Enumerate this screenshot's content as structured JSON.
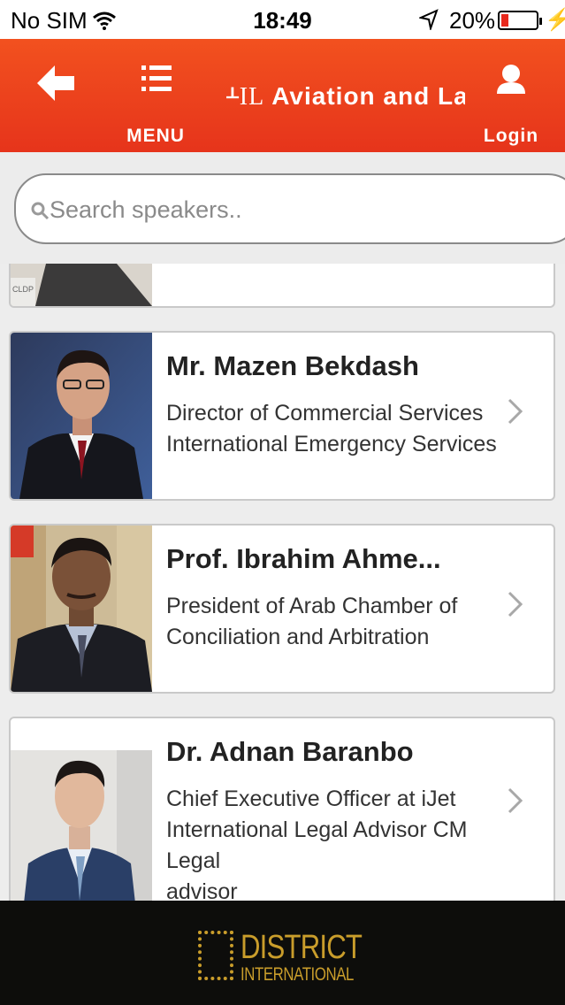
{
  "status_bar": {
    "carrier": "No SIM",
    "time": "18:49",
    "battery_percent": "20%",
    "battery_level": 0.2,
    "battery_color": "#e8281c"
  },
  "header": {
    "background_color": "#e8391c",
    "back_icon": "arrow-left-icon",
    "menu_label": "MENU",
    "menu_icon": "list-icon",
    "logo_mark": "ᚆIL",
    "title": "Aviation and La",
    "login_label": "Login",
    "login_icon": "user-icon"
  },
  "search": {
    "placeholder": "Search speakers..",
    "icon": "search-icon"
  },
  "speakers": [
    {
      "name": "",
      "role_lines": [
        "",
        ""
      ],
      "photo_icon": "person-photo",
      "badge": "CLDP"
    },
    {
      "name": "Mr. Mazen Bekdash",
      "role_lines": [
        "Director of Commercial Services",
        "International Emergency Services"
      ],
      "photo_icon": "person-photo"
    },
    {
      "name": "Prof. Ibrahim Ahme...",
      "role_lines": [
        "President of Arab Chamber of",
        "Conciliation and Arbitration"
      ],
      "photo_icon": "person-photo"
    },
    {
      "name": "Dr. Adnan Baranbo",
      "role_lines": [
        "Chief Executive Officer at iJet",
        "International Legal Advisor CM Legal",
        "advisor"
      ],
      "photo_icon": "person-photo"
    }
  ],
  "footer": {
    "brand_line1": "DISTRICT",
    "brand_line2": "INTERNATIONAL",
    "brand_color": "#c99d2b"
  }
}
